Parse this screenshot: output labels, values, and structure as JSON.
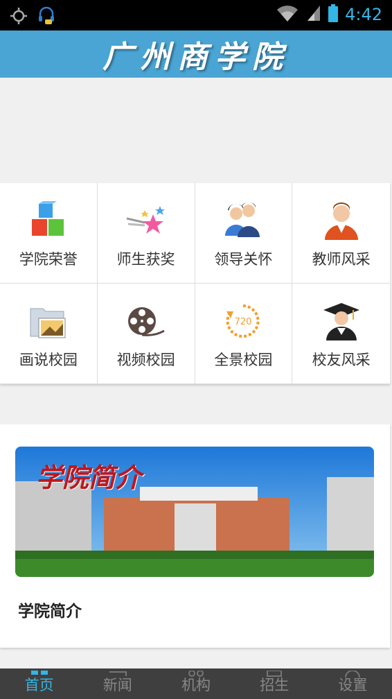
{
  "status_bar": {
    "clock": "4:42",
    "icons": [
      "gps-icon",
      "headset-icon",
      "wifi-icon",
      "signal-icon",
      "battery-icon"
    ]
  },
  "header": {
    "title": "广州商学院"
  },
  "grid": {
    "items": [
      {
        "label": "学院荣誉",
        "icon": "cubes-icon"
      },
      {
        "label": "师生获奖",
        "icon": "stars-icon"
      },
      {
        "label": "领导关怀",
        "icon": "leaders-icon"
      },
      {
        "label": "教师风采",
        "icon": "teacher-icon"
      },
      {
        "label": "画说校园",
        "icon": "folder-photo-icon"
      },
      {
        "label": "视频校园",
        "icon": "film-reel-icon"
      },
      {
        "label": "全景校园",
        "icon": "panorama-720-icon"
      },
      {
        "label": "校友风采",
        "icon": "graduate-icon"
      }
    ]
  },
  "intro": {
    "photo_title": "学院简介",
    "caption": "学院简介"
  },
  "tab_bar": {
    "tabs": [
      {
        "label": "首页",
        "active": true
      },
      {
        "label": "新闻",
        "active": false
      },
      {
        "label": "机构",
        "active": false
      },
      {
        "label": "招生",
        "active": false
      },
      {
        "label": "设置",
        "active": false
      }
    ]
  },
  "colors": {
    "accent": "#33b5e5",
    "header_bg": "#4aa5d4",
    "tab_bar_bg": "#3f3f3f"
  }
}
